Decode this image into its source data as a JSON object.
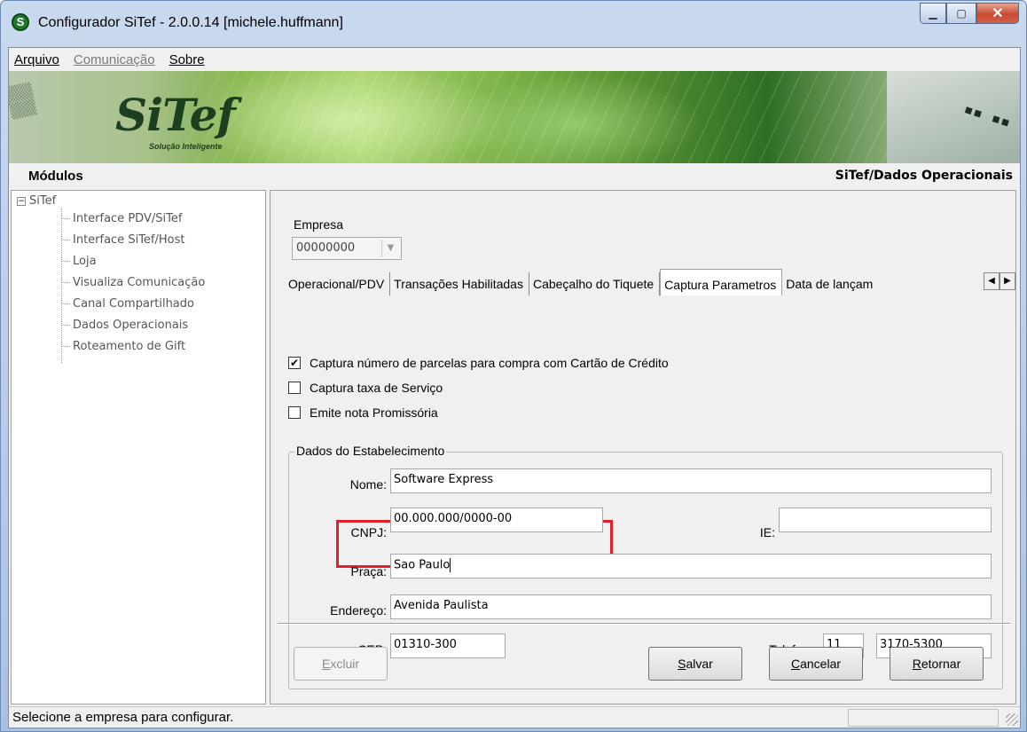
{
  "window": {
    "title": "Configurador SiTef - 2.0.0.14  [michele.huffmann]",
    "icon_letter": "S",
    "controls": {
      "minimize": "minimize-icon",
      "maximize": "maximize-icon",
      "close": "close-icon"
    }
  },
  "menu": {
    "items": [
      "Arquivo",
      "Comunicação",
      "Sobre"
    ],
    "disabled": [
      "Comunicação"
    ]
  },
  "banner": {
    "logo": "SiTef",
    "tagline": "Solução Inteligente"
  },
  "header": {
    "left": "Módulos",
    "right": "SiTef/Dados Operacionais"
  },
  "tree": {
    "root": "SiTef",
    "expander": "⊟",
    "items": [
      "Interface PDV/SiTef",
      "Interface SiTef/Host",
      "Loja",
      "Visualiza Comunicação",
      "Canal Compartilhado",
      "Dados Operacionais",
      "Roteamento de Gift"
    ]
  },
  "form": {
    "empresa_label": "Empresa",
    "empresa_value": "00000000",
    "tabs": [
      "Operacional/PDV",
      "Transações Habilitadas",
      "Cabeçalho do Tiquete",
      "Captura Parametros",
      "Data de lançam"
    ],
    "active_tab": "Captura Parametros",
    "checkboxes": [
      {
        "label": "Captura número de parcelas para compra com Cartão de Crédito",
        "checked": true
      },
      {
        "label": "Captura taxa de Serviço",
        "checked": false
      },
      {
        "label": "Emite nota Promissória",
        "checked": false
      }
    ],
    "group_title": "Dados do Estabelecimento",
    "fields": {
      "nome": {
        "label": "Nome:",
        "value": "Software Express"
      },
      "cnpj": {
        "label": "CNPJ:",
        "value": "00.000.000/0000-00"
      },
      "ie": {
        "label": "IE:",
        "value": ""
      },
      "praca": {
        "label": "Praça:",
        "value": "Sao Paulo"
      },
      "endereco": {
        "label": "Endereço:",
        "value": "Avenida Paulista"
      },
      "cep": {
        "label": "CEP:",
        "value": "01310-300"
      },
      "telefone": {
        "label": "Telefone:",
        "ddd": "11",
        "numero": "3170-5300"
      }
    },
    "highlight_color": "#e0202b"
  },
  "buttons": {
    "excluir": {
      "first": "E",
      "rest": "xcluir",
      "enabled": false
    },
    "salvar": {
      "first": "S",
      "rest": "alvar"
    },
    "cancelar": {
      "first": "C",
      "rest": "ancelar"
    },
    "retornar": {
      "first": "R",
      "rest": "etornar"
    }
  },
  "status": {
    "text": "Selecione a empresa para configurar."
  }
}
